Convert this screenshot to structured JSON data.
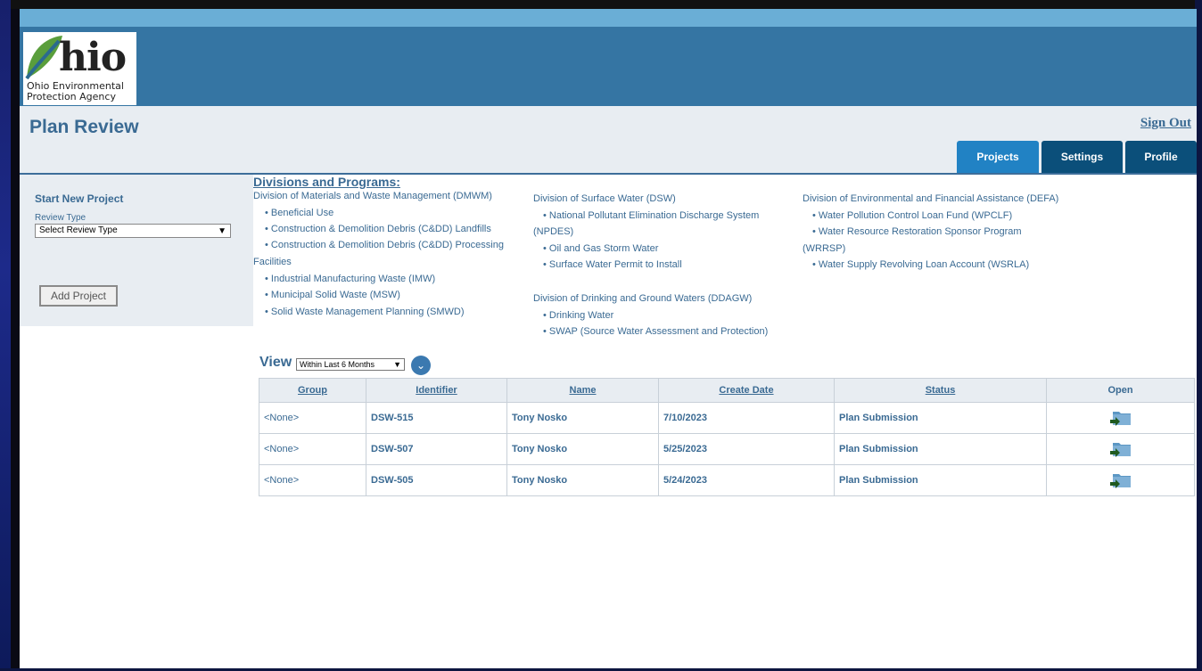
{
  "app": {
    "agency_logo_word": "hio",
    "agency_logo_line1": "Ohio Environmental",
    "agency_logo_line2": "Protection Agency",
    "page_title": "Plan Review",
    "sign_out_label": "Sign Out"
  },
  "tabs": [
    {
      "label": "Projects",
      "active": true
    },
    {
      "label": "Settings",
      "active": false
    },
    {
      "label": "Profile",
      "active": false
    }
  ],
  "sidebar": {
    "title": "Start New Project",
    "review_type_label": "Review Type",
    "review_type_value": "Select Review Type",
    "add_project_label": "Add Project"
  },
  "divisions": {
    "heading": "Divisions and Programs:",
    "col1": [
      "Division of Materials and Waste Management (DMWM)",
      "• Beneficial Use",
      "• Construction & Demolition Debris (C&DD) Landfills",
      "• Construction & Demolition Debris (C&DD) Processing",
      "Facilities",
      "• Industrial Manufacturing Waste (IMW)",
      "• Municipal Solid Waste (MSW)",
      "• Solid Waste Management Planning (SMWD)"
    ],
    "col2": [
      "Division of Surface Water (DSW)",
      "• National Pollutant Elimination Discharge System",
      "(NPDES)",
      "• Oil and Gas Storm Water",
      "• Surface Water Permit to Install",
      "Division of Drinking and Ground Waters (DDAGW)",
      "• Drinking Water",
      "• SWAP (Source Water Assessment and Protection)"
    ],
    "col3": [
      "Division of Environmental and Financial Assistance (DEFA)",
      "• Water Pollution Control Loan Fund (WPCLF)",
      "• Water Resource Restoration Sponsor Program",
      "(WRRSP)",
      "• Water Supply Revolving Loan Account (WSRLA)"
    ]
  },
  "view": {
    "label": "View",
    "filter_value": "Within Last 6 Months"
  },
  "table": {
    "headers": [
      "Group",
      "Identifier",
      "Name",
      "Create Date",
      "Status",
      "Open"
    ],
    "rows": [
      {
        "group": "<None>",
        "identifier": "DSW-515",
        "name": "Tony Nosko",
        "create_date": "7/10/2023",
        "status": "Plan Submission",
        "open_icon": "folder-open-icon"
      },
      {
        "group": "<None>",
        "identifier": "DSW-507",
        "name": "Tony Nosko",
        "create_date": "5/25/2023",
        "status": "Plan Submission",
        "open_icon": "folder-open-icon"
      },
      {
        "group": "<None>",
        "identifier": "DSW-505",
        "name": "Tony Nosko",
        "create_date": "5/24/2023",
        "status": "Plan Submission",
        "open_icon": "folder-open-icon"
      }
    ]
  },
  "colors": {
    "banner": "#3575a3",
    "accent_text": "#3a6a93",
    "tab_active": "#2182c4",
    "tab_inactive": "#0b4f7a"
  }
}
